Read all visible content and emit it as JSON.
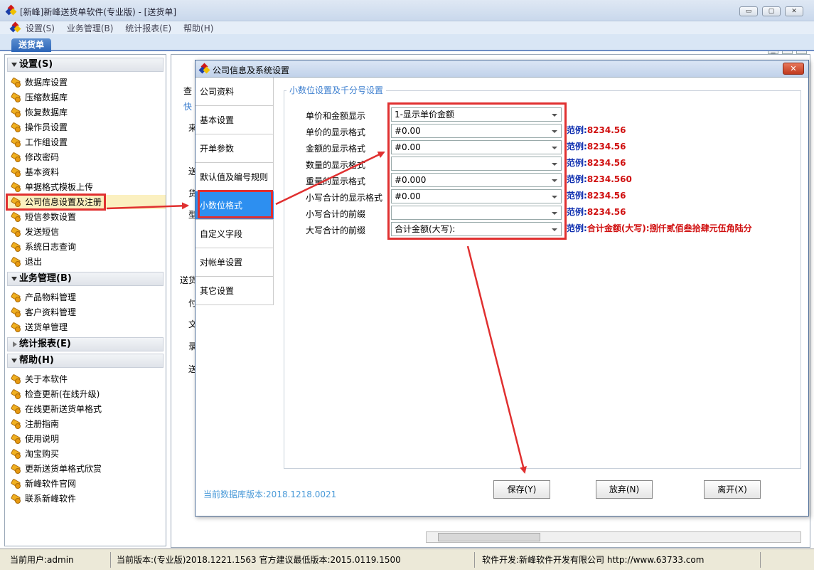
{
  "window": {
    "title": "[新峰]新峰送货单软件(专业版) - [送货单]",
    "min_glyph": "▭",
    "max_glyph": "▢",
    "close_glyph": "✕"
  },
  "menu": {
    "items": [
      "设置(S)",
      "业务管理(B)",
      "统计报表(E)",
      "帮助(H)"
    ],
    "mdi_buttons": [
      "_",
      "▫",
      "✕"
    ]
  },
  "tab": {
    "label": "送货单"
  },
  "sidebar": {
    "sections": [
      {
        "label": "设置(S)",
        "items": [
          "数据库设置",
          "压缩数据库",
          "恢复数据库",
          "操作员设置",
          "工作组设置",
          "修改密码",
          "基本资料",
          "单据格式模板上传",
          "公司信息设置及注册",
          "短信参数设置",
          "发送短信",
          "系统日志查询",
          "退出"
        ]
      },
      {
        "label": "业务管理(B)",
        "items": [
          "产品物料管理",
          "客户资料管理",
          "送货单管理"
        ]
      },
      {
        "label": "统计报表(E)",
        "items": []
      },
      {
        "label": "帮助(H)",
        "items": [
          "关于本软件",
          "检查更新(在线升级)",
          "在线更新送货单格式",
          "注册指南",
          "使用说明",
          "淘宝购买",
          "更新送货单格式欣赏",
          "新峰软件官网",
          "联系新峰软件"
        ]
      }
    ]
  },
  "background": {
    "labels": [
      "查",
      "快",
      "来",
      "送",
      "货",
      "型",
      "送货",
      "付",
      "文",
      "录",
      "送"
    ]
  },
  "dialog": {
    "title": "公司信息及系统设置",
    "close_glyph": "✕",
    "nav": [
      "公司资料",
      "基本设置",
      "开单参数",
      "默认值及编号规则",
      "小数位格式",
      "自定义字段",
      "对帐单设置",
      "其它设置"
    ],
    "active_nav": "小数位格式",
    "group_title": "小数位设置及千分号设置",
    "rows": [
      {
        "label": "单价和金额显示",
        "value": "1-显示单价金额",
        "example_prefix": "",
        "example_value": ""
      },
      {
        "label": "单价的显示格式",
        "value": "#0.00",
        "example_prefix": "范例:",
        "example_value": "8234.56"
      },
      {
        "label": "金额的显示格式",
        "value": "#0.00",
        "example_prefix": "范例:",
        "example_value": "8234.56"
      },
      {
        "label": "数量的显示格式",
        "value": "",
        "example_prefix": "范例:",
        "example_value": "8234.56"
      },
      {
        "label": "重量的显示格式",
        "value": "#0.000",
        "example_prefix": "范例:",
        "example_value": "8234.560"
      },
      {
        "label": "小写合计的显示格式",
        "value": "#0.00",
        "example_prefix": "范例:",
        "example_value": "8234.56"
      },
      {
        "label": "小写合计的前缀",
        "value": "",
        "example_prefix": "范例:",
        "example_value": "8234.56"
      },
      {
        "label": "大写合计的前缀",
        "value": "合计金额(大写):",
        "example_prefix": "范例:",
        "example_value": "合计金额(大写):捌仟贰佰叁拾肆元伍角陆分"
      }
    ],
    "db_version": "当前数据库版本:2018.1218.0021",
    "buttons": {
      "save": "保存(Y)",
      "discard": "放弃(N)",
      "leave": "离开(X)"
    }
  },
  "statusbar": {
    "user": "当前用户:admin",
    "version": "当前版本:(专业版)2018.1221.1563 官方建议最低版本:2015.0119.1500",
    "developer": "软件开发:新峰软件开发有限公司 http://www.63733.com"
  },
  "colors": {
    "accent": "#2d8ff0",
    "highlight_box": "#e03030",
    "example_value": "#d01010",
    "example_prefix": "#1030b0"
  }
}
